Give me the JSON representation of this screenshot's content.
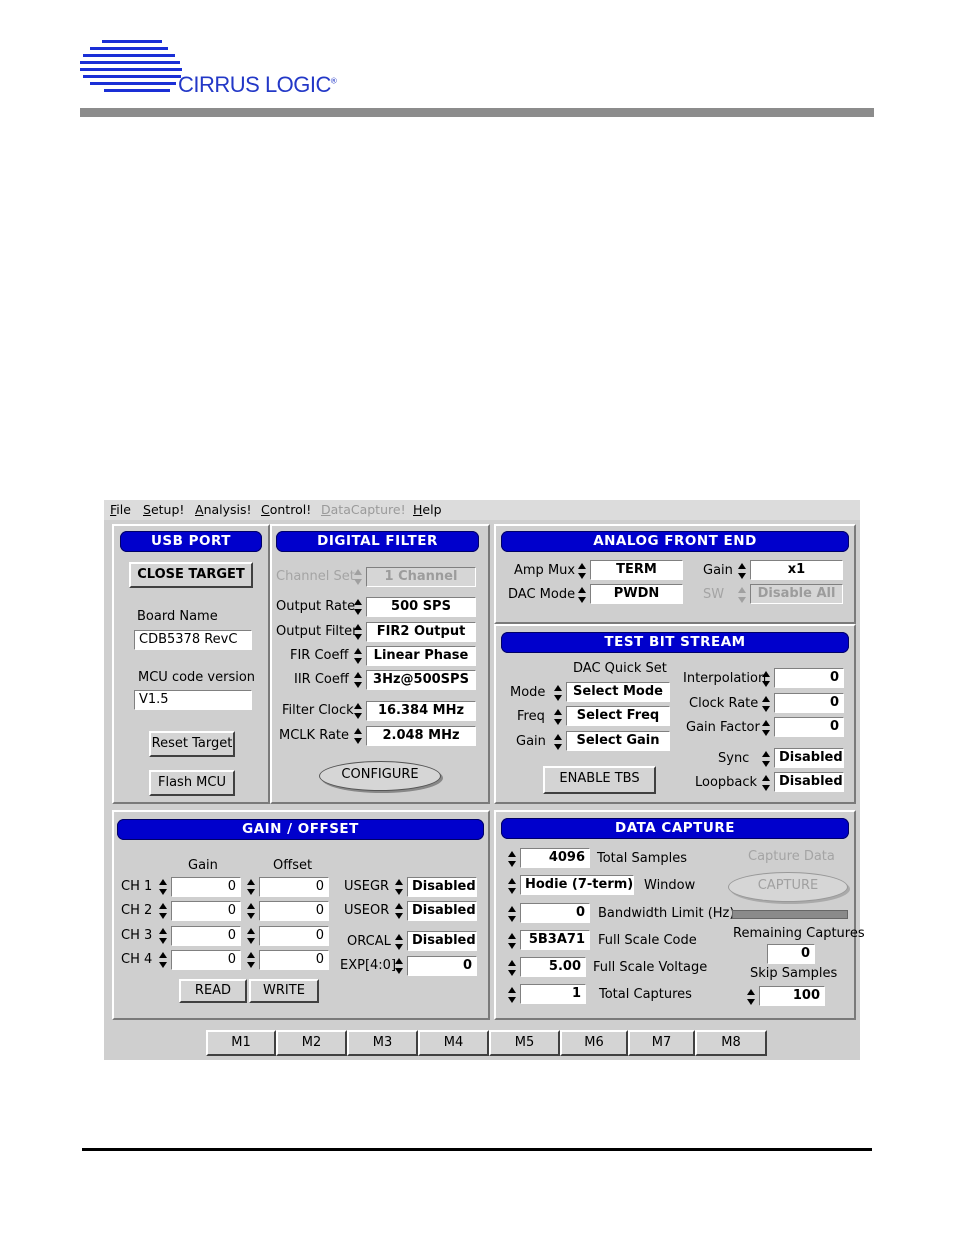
{
  "brand": {
    "name": "CIRRUS LOGIC",
    "registered": "®",
    "accent": "#1a2fd6"
  },
  "menu": [
    {
      "label": "File",
      "underline": "F",
      "rest": "ile",
      "enabled": true
    },
    {
      "label": "Setup!",
      "underline": "S",
      "rest": "etup!",
      "enabled": true
    },
    {
      "label": "Analysis!",
      "underline": "A",
      "rest": "nalysis!",
      "enabled": true
    },
    {
      "label": "Control!",
      "underline": "C",
      "rest": "ontrol!",
      "enabled": true
    },
    {
      "label": "DataCapture!",
      "underline": "D",
      "rest": "ataCapture!",
      "enabled": false
    },
    {
      "label": "Help",
      "underline": "H",
      "rest": "elp",
      "enabled": true
    }
  ],
  "usb": {
    "title": "USB PORT",
    "close_target": "CLOSE TARGET",
    "board_name_label": "Board Name",
    "board_name": "CDB5378 RevC",
    "mcu_label": "MCU code version",
    "mcu_version": "V1.5",
    "reset_target": "Reset Target",
    "flash_mcu": "Flash MCU"
  },
  "filter": {
    "title": "DIGITAL FILTER",
    "channel_set_label": "Channel Set",
    "channel_set": "1 Channel",
    "output_rate_label": "Output Rate",
    "output_rate": "500 SPS",
    "output_filter_label": "Output Filter",
    "output_filter": "FIR2 Output",
    "fir_coeff_label": "FIR Coeff",
    "fir_coeff": "Linear Phase",
    "iir_coeff_label": "IIR Coeff",
    "iir_coeff": "3Hz@500SPS",
    "filter_clock_label": "Filter Clock",
    "filter_clock": "16.384 MHz",
    "mclk_rate_label": "MCLK Rate",
    "mclk_rate": "2.048 MHz",
    "configure": "CONFIGURE"
  },
  "afe": {
    "title": "ANALOG FRONT END",
    "amp_mux_label": "Amp Mux",
    "amp_mux": "TERM",
    "dac_mode_label": "DAC Mode",
    "dac_mode": "PWDN",
    "gain_label": "Gain",
    "gain": "x1",
    "sw_label": "SW",
    "sw": "Disable All"
  },
  "tbs": {
    "title": "TEST BIT STREAM",
    "dac_quick_set_label": "DAC Quick Set",
    "mode_label": "Mode",
    "mode": "Select Mode",
    "freq_label": "Freq",
    "freq": "Select Freq",
    "gain_label": "Gain",
    "gain": "Select Gain",
    "interpolation_label": "Interpolation",
    "interpolation": "0",
    "clock_rate_label": "Clock Rate",
    "clock_rate": "0",
    "gain_factor_label": "Gain Factor",
    "gain_factor": "0",
    "sync_label": "Sync",
    "sync": "Disabled",
    "loopback_label": "Loopback",
    "loopback": "Disabled",
    "enable": "ENABLE TBS"
  },
  "gain_offset": {
    "title": "GAIN / OFFSET",
    "gain_header": "Gain",
    "offset_header": "Offset",
    "channels": [
      {
        "label": "CH 1",
        "gain": "0",
        "offset": "0"
      },
      {
        "label": "CH 2",
        "gain": "0",
        "offset": "0"
      },
      {
        "label": "CH 3",
        "gain": "0",
        "offset": "0"
      },
      {
        "label": "CH 4",
        "gain": "0",
        "offset": "0"
      }
    ],
    "usegr_label": "USEGR",
    "usegr": "Disabled",
    "useor_label": "USEOR",
    "useor": "Disabled",
    "orcal_label": "ORCAL",
    "orcal": "Disabled",
    "exp_label": "EXP[4:0]",
    "exp": "0",
    "read": "READ",
    "write": "WRITE"
  },
  "capture": {
    "title": "DATA CAPTURE",
    "total_samples": "4096",
    "total_samples_label": "Total Samples",
    "window": "Hodie (7-term)",
    "window_label": "Window",
    "bandwidth": "0",
    "bandwidth_label": "Bandwidth Limit (Hz)",
    "full_scale_code": "5B3A71",
    "full_scale_code_label": "Full Scale Code",
    "full_scale_voltage": "5.00",
    "full_scale_voltage_label": "Full Scale Voltage",
    "total_captures": "1",
    "total_captures_label": "Total Captures",
    "capture_data_label": "Capture Data",
    "capture_button": "CAPTURE",
    "remaining_label": "Remaining Captures",
    "remaining": "0",
    "skip_label": "Skip Samples",
    "skip": "100"
  },
  "tabs": [
    "M1",
    "M2",
    "M3",
    "M4",
    "M5",
    "M6",
    "M7",
    "M8"
  ]
}
